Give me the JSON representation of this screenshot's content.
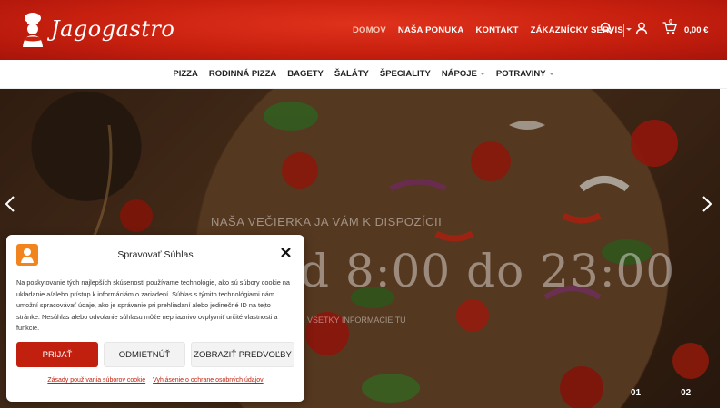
{
  "brand": {
    "name": "Jagogastro"
  },
  "main_nav": {
    "items": [
      {
        "label": "DOMOV",
        "active": true
      },
      {
        "label": "NAŠA PONUKA"
      },
      {
        "label": "KONTAKT"
      },
      {
        "label": "ZÁKAZNÍCKY SERVIS",
        "has_dropdown": true
      }
    ]
  },
  "header_icons": {
    "search": "search-icon",
    "account": "user-icon",
    "cart": "cart-icon",
    "cart_count": "0",
    "cart_total": "0,00 €"
  },
  "category_nav": {
    "items": [
      {
        "label": "PIZZA"
      },
      {
        "label": "RODINNÁ PIZZA"
      },
      {
        "label": "BAGETY"
      },
      {
        "label": "ŠALÁTY"
      },
      {
        "label": "ŠPECIALITY"
      },
      {
        "label": "NÁPOJE",
        "has_dropdown": true
      },
      {
        "label": "POTRAVINY",
        "has_dropdown": true
      }
    ]
  },
  "hero": {
    "kicker": "NAŠA VEČIERKA JA VÁM K DISPOZÍCII",
    "hours": "d 8:00 do 23:00",
    "subtitle": "VŠETKY INFORMÁCIE TU",
    "slides": [
      "01",
      "02"
    ]
  },
  "consent": {
    "title": "Spravovať Súhlas",
    "text": "Na poskytovanie tých najlepších skúseností používame technológie, ako sú súbory cookie na ukladanie a/alebo prístup k informáciám o zariadení. Súhlas s týmito technológiami nám umožní spracovávať údaje, ako je správanie pri prehliadaní alebo jedinečné ID na tejto stránke. Nesúhlas alebo odvolanie súhlasu môže nepriaznivo ovplyvniť určité vlastnosti a funkcie.",
    "accept": "PRIJAŤ",
    "deny": "ODMIETNÚŤ",
    "prefs": "ZOBRAZIŤ PREDVOĽBY",
    "link_cookie": "Zásady používania súborov cookie",
    "link_privacy": "Vyhlásenie o ochrane osobných údajov"
  },
  "colors": {
    "brand_red": "#c8200f",
    "accent_orange": "#f2841e"
  }
}
